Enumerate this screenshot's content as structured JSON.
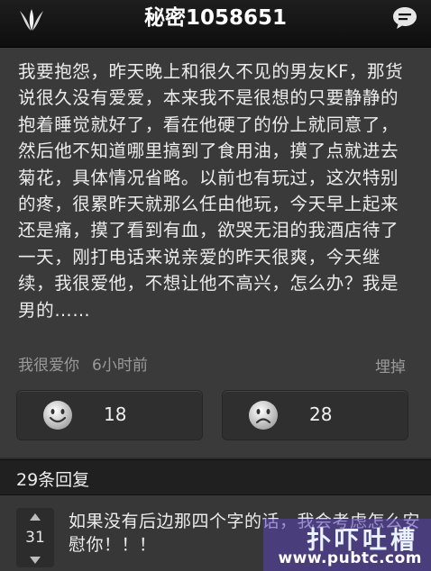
{
  "header": {
    "title": "秘密1058651",
    "left_icon": "leaf-logo-icon",
    "right_icon": "chat-bubble-icon"
  },
  "post": {
    "body": "我要抱怨，昨天晚上和很久不见的男友KF，那货说很久没有爱爱，本来我不是很想的只要静静的抱着睡觉就好了，看在他硬了的份上就同意了，然后他不知道哪里搞到了食用油，摸了点就进去菊花，具体情况省略。以前也有玩过，这次特别的疼，很累昨天就那么任由他玩，今天早上起来还是痛，摸了看到有血，欲哭无泪的我酒店待了一天，刚打电话来说亲爱的昨天很爽，今天继续，我很爱他，不想让他不高兴，怎么办？我是男的……",
    "author": "我很爱你",
    "time": "6小时前",
    "bury_label": "埋掉",
    "like_count": "18",
    "dislike_count": "28"
  },
  "replies": {
    "header": "29条回复",
    "items": [
      {
        "votes": "31",
        "text": "如果没有后边那四个字的话，我会考虑怎么安慰你！！！"
      }
    ]
  },
  "watermark": {
    "title": "扑吓吐槽",
    "url": "www.pubtc.com"
  },
  "colors": {
    "background": "#3a3a3a",
    "topbar": "#111111",
    "text": "#ececec",
    "muted": "#9a9a9a"
  }
}
